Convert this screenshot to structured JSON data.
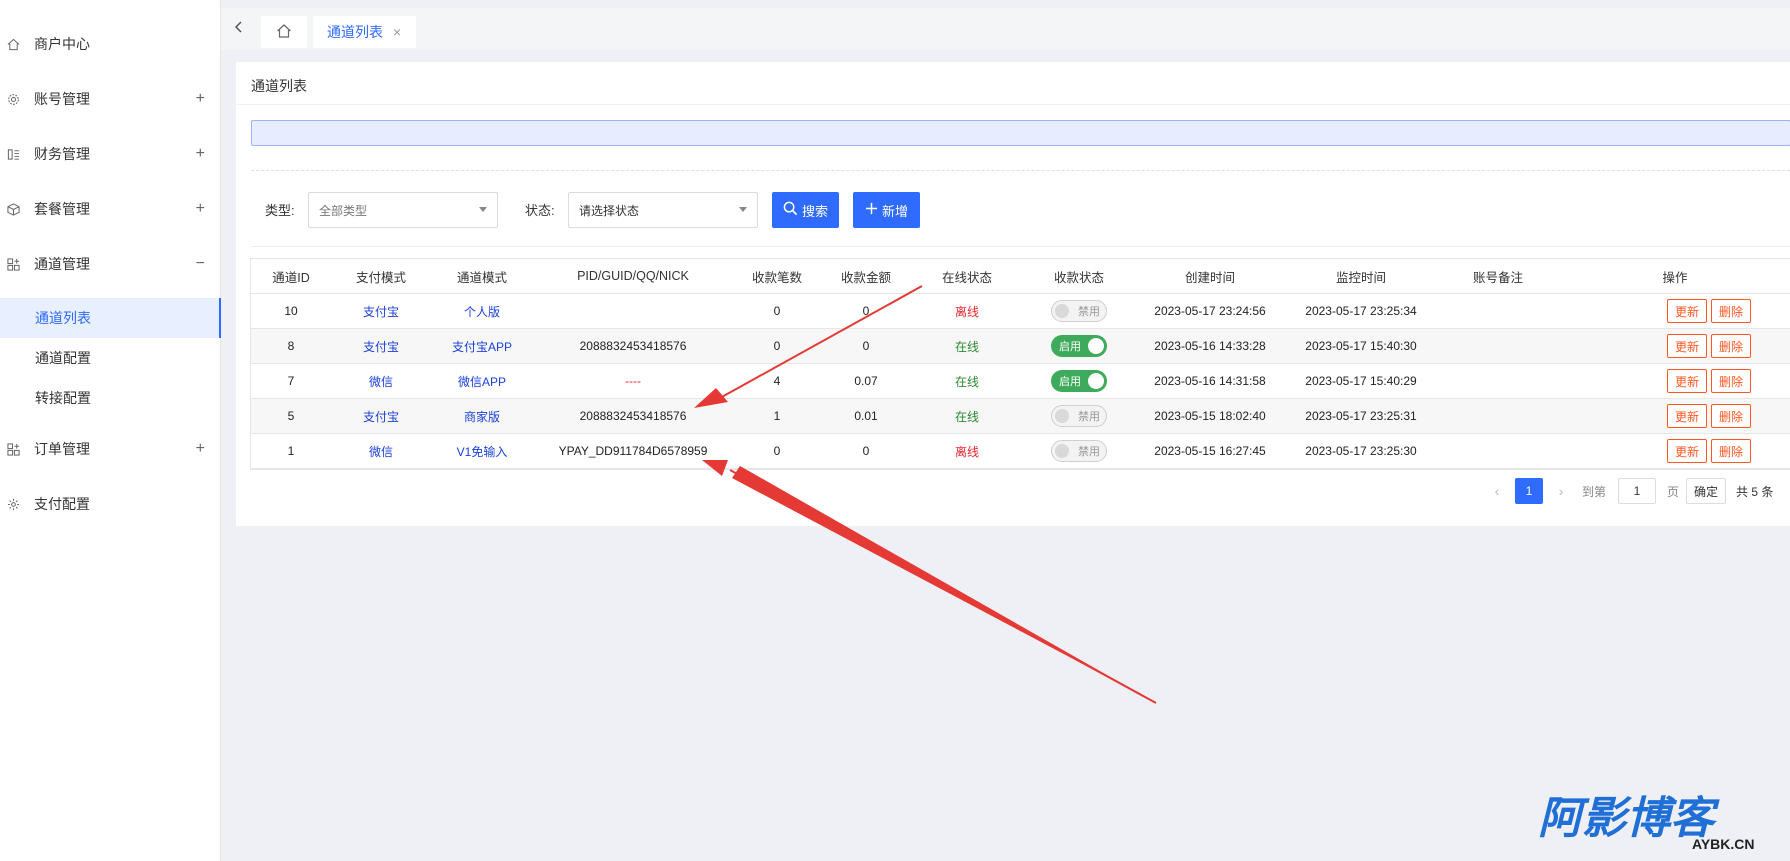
{
  "sidebar": {
    "items": [
      {
        "label": "商户中心",
        "icon": "home-outline-icon",
        "toggle": ""
      },
      {
        "label": "账号管理",
        "icon": "gear-icon",
        "toggle": "+"
      },
      {
        "label": "财务管理",
        "icon": "ledger-icon",
        "toggle": "+"
      },
      {
        "label": "套餐管理",
        "icon": "cube-icon",
        "toggle": "+"
      },
      {
        "label": "通道管理",
        "icon": "apps-icon",
        "toggle": "−"
      },
      {
        "label": "订单管理",
        "icon": "apps-icon",
        "toggle": "+"
      },
      {
        "label": "支付配置",
        "icon": "settings-icon",
        "toggle": ""
      }
    ],
    "subitems": [
      {
        "label": "通道列表",
        "active": true
      },
      {
        "label": "通道配置",
        "active": false
      },
      {
        "label": "转接配置",
        "active": false
      }
    ]
  },
  "tabs": {
    "active_label": "通道列表",
    "close": "×"
  },
  "card": {
    "title": "通道列表"
  },
  "filters": {
    "type_label": "类型:",
    "type_value": "全部类型",
    "status_label": "状态:",
    "status_value": "请选择状态",
    "search_label": "搜索",
    "add_label": "新增"
  },
  "table": {
    "headers": [
      "通道ID",
      "支付模式",
      "通道模式",
      "PID/GUID/QQ/NICK",
      "收款笔数",
      "收款金额",
      "在线状态",
      "收款状态",
      "创建时间",
      "监控时间",
      "账号备注",
      "操作"
    ],
    "rows": [
      {
        "id": "10",
        "pay_mode": "支付宝",
        "channel_mode": "个人版",
        "pid": "",
        "count": "0",
        "amount": "0",
        "online": "离线",
        "online_state": "offline",
        "collect": "禁用",
        "collect_on": false,
        "created": "2023-05-17 23:24:56",
        "monitored": "2023-05-17 23:25:34",
        "remark": "",
        "update": "更新",
        "delete": "删除"
      },
      {
        "id": "8",
        "pay_mode": "支付宝",
        "channel_mode": "支付宝APP",
        "pid": "2088832453418576",
        "count": "0",
        "amount": "0",
        "online": "在线",
        "online_state": "online",
        "collect": "启用",
        "collect_on": true,
        "created": "2023-05-16 14:33:28",
        "monitored": "2023-05-17 15:40:30",
        "remark": "",
        "update": "更新",
        "delete": "删除"
      },
      {
        "id": "7",
        "pay_mode": "微信",
        "channel_mode": "微信APP",
        "pid": "----",
        "count": "4",
        "amount": "0.07",
        "online": "在线",
        "online_state": "online",
        "collect": "启用",
        "collect_on": true,
        "created": "2023-05-16 14:31:58",
        "monitored": "2023-05-17 15:40:29",
        "remark": "",
        "update": "更新",
        "delete": "删除"
      },
      {
        "id": "5",
        "pay_mode": "支付宝",
        "channel_mode": "商家版",
        "pid": "2088832453418576",
        "count": "1",
        "amount": "0.01",
        "online": "在线",
        "online_state": "online",
        "collect": "禁用",
        "collect_on": false,
        "created": "2023-05-15 18:02:40",
        "monitored": "2023-05-17 23:25:31",
        "remark": "",
        "update": "更新",
        "delete": "删除"
      },
      {
        "id": "1",
        "pay_mode": "微信",
        "channel_mode": "V1免输入",
        "pid": "YPAY_DD911784D6578959",
        "count": "0",
        "amount": "0",
        "online": "离线",
        "online_state": "offline",
        "collect": "禁用",
        "collect_on": false,
        "created": "2023-05-15 16:27:45",
        "monitored": "2023-05-17 23:25:30",
        "remark": "",
        "update": "更新",
        "delete": "删除"
      }
    ]
  },
  "pagination": {
    "current": "1",
    "goto_label": "到第",
    "goto_value": "1",
    "page_unit": "页",
    "confirm": "确定",
    "total": "共 5 条"
  },
  "watermark": {
    "text": "阿影博客",
    "domain": "AYBK.CN"
  },
  "colors": {
    "primary": "#2f6bff",
    "danger": "#ff5722",
    "online": "#2a8a32",
    "offline": "#e5262b",
    "toggle_on": "#3eaa5b",
    "arrow": "#e53935"
  }
}
